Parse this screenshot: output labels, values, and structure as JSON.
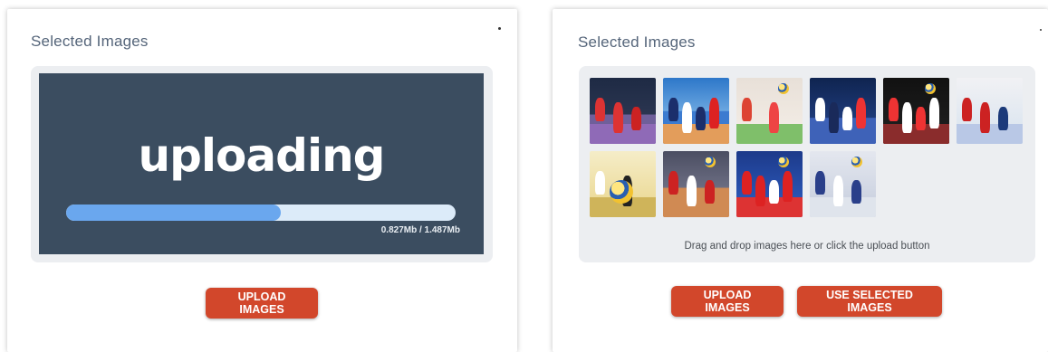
{
  "left_panel": {
    "title": "Selected Images",
    "uploading_text": "uploading",
    "progress_fraction": 0.55,
    "progress_readout": "0.827Mb / 1.487Mb",
    "upload_button": "UPLOAD IMAGES"
  },
  "right_panel": {
    "title": "Selected Images",
    "thumbnails": [
      "volleyball-photo-1",
      "volleyball-photo-2",
      "volleyball-photo-3",
      "volleyball-photo-4",
      "volleyball-photo-5",
      "volleyball-photo-6",
      "volleyball-photo-7",
      "volleyball-photo-8",
      "volleyball-photo-9",
      "volleyball-photo-10"
    ],
    "drop_hint": "Drag and drop images here or click the upload button",
    "upload_button": "UPLOAD IMAGES",
    "use_selected_button": "USE SELECTED IMAGES"
  },
  "colors": {
    "accent_button": "#d2472b",
    "upload_screen": "#3b4d60",
    "progress_fill": "#6aa7ee",
    "progress_track": "#dcebf9"
  }
}
